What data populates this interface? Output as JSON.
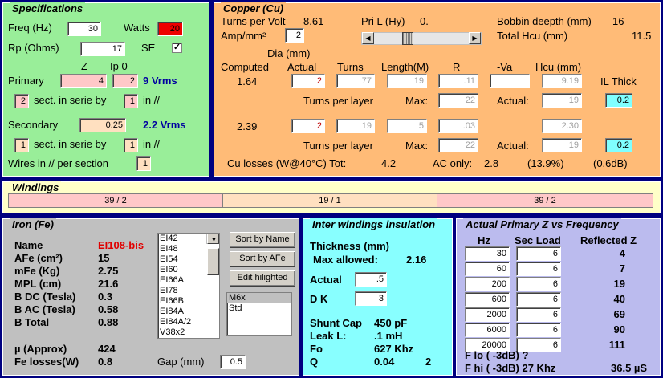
{
  "spec": {
    "title": "Specifications",
    "freq_label": "Freq (Hz)",
    "freq_value": "30",
    "watts_label": "Watts",
    "watts_value": "20",
    "rp_label": "Rp (Ohms)",
    "rp_value": "17",
    "se_label": "SE",
    "se_checked": "✓",
    "z_label": "Z",
    "ip0_label": "Ip 0",
    "primary_label": "Primary",
    "primary_z": "4",
    "primary_ip0": "2",
    "primary_vrms": "9 Vrms",
    "primary_sect": "2",
    "sect_label": "sect. in serie by",
    "primary_by": "1",
    "in_label": "in //",
    "secondary_label": "Secondary",
    "secondary_z": "0.25",
    "secondary_vrms": "2.2 Vrms",
    "secondary_sect": "1",
    "secondary_by": "1",
    "wires_label": "Wires in // per section",
    "wires_value": "1"
  },
  "copper": {
    "title": "Copper (Cu)",
    "tpv_label": "Turns per Volt",
    "tpv_value": "8.61",
    "pril_label": "Pri L (Hy)",
    "pril_value": "0.",
    "bobbin_label": "Bobbin deepth (mm)",
    "bobbin_value": "16",
    "amp_label": "Amp/mm²",
    "amp_value": "2",
    "hcu_label": "Total Hcu (mm)",
    "hcu_value": "11.5",
    "dia_label": "Dia (mm)",
    "computed_label": "Computed",
    "actual_label": "Actual",
    "turns_label": "Turns",
    "length_label": "Length(M)",
    "r_label": "R",
    "va_label": "-Va",
    "hcu_col_label": "Hcu (mm)",
    "p_computed": "1.64",
    "p_actual": "2",
    "p_turns": "77",
    "p_length": "19",
    "p_r": ".11",
    "p_va": "",
    "p_hcu": "9.19",
    "il_label": "IL Thick",
    "tpl_label": "Turns per layer",
    "max_label": "Max:",
    "actual2_label": "Actual:",
    "p_max": "22",
    "p_actual_tpl": "19",
    "p_il": "0.2",
    "s_computed": "2.39",
    "s_actual": "2",
    "s_turns": "19",
    "s_length": "5",
    "s_r": ".03",
    "s_hcu": "2.30",
    "s_max": "22",
    "s_actual_tpl": "19",
    "s_il": "0.2",
    "culoss_label": "Cu losses (W@40°C) Tot:",
    "culoss_tot": "4.2",
    "aconly_label": "AC only:",
    "aconly_value": "2.8",
    "aconly_pct": "(13.9%)",
    "aconly_db": "(0.6dB)"
  },
  "windings": {
    "title": "Windings",
    "segments": [
      "39 / 2",
      "19 / 1",
      "39 / 2"
    ]
  },
  "iron": {
    "title": "Iron (Fe)",
    "name_label": "Name",
    "name_value": "EI108-bis",
    "afe_label": "AFe (cm²)",
    "afe_value": "15",
    "mfe_label": "mFe (Kg)",
    "mfe_value": "2.75",
    "mpl_label": "MPL (cm)",
    "mpl_value": "21.6",
    "bdc_label": "B DC (Tesla)",
    "bdc_value": "0.3",
    "bac_label": "B AC (Tesla)",
    "bac_value": "0.58",
    "btot_label": "B Total",
    "btot_value": "0.88",
    "mu_label": "µ (Approx)",
    "mu_value": "424",
    "fel_label": "Fe losses(W)",
    "fel_value": "0.8",
    "gap_label": "Gap (mm)",
    "gap_value": "0.5",
    "cores": [
      "EI42",
      "EI48",
      "EI54",
      "EI60",
      "EI66A",
      "EI78",
      "EI66B",
      "EI84A",
      "EI84A/2",
      "V38x2"
    ],
    "sort_name": "Sort by Name",
    "sort_afe": "Sort by AFe",
    "edit_hl": "Edit hilighted",
    "materials": [
      "M6x",
      "Std"
    ]
  },
  "insulation": {
    "title": "Inter windings insulation",
    "thick_label": "Thickness (mm)",
    "maxallow_label": "Max allowed:",
    "maxallow_value": "2.16",
    "actual_label": "Actual",
    "actual_value": ".5",
    "dk_label": "D K",
    "dk_value": "3",
    "shunt_label": "Shunt Cap",
    "shunt_value": "450 pF",
    "leak_label": "Leak L:",
    "leak_value": ".1 mH",
    "fo_label": "Fo",
    "fo_value": "627 Khz",
    "q_label": "Q",
    "q_value": "0.04",
    "q_extra": "2"
  },
  "zfreq": {
    "title": "Actual Primary Z vs Frequency",
    "hz_label": "Hz",
    "secload_label": "Sec Load",
    "refz_label": "Reflected Z",
    "rows": [
      {
        "hz": "30",
        "load": "6",
        "z": "4"
      },
      {
        "hz": "60",
        "load": "6",
        "z": "7"
      },
      {
        "hz": "200",
        "load": "6",
        "z": "19"
      },
      {
        "hz": "600",
        "load": "6",
        "z": "40"
      },
      {
        "hz": "2000",
        "load": "6",
        "z": "69"
      },
      {
        "hz": "6000",
        "load": "6",
        "z": "90"
      },
      {
        "hz": "20000",
        "load": "6",
        "z": "111"
      }
    ],
    "flo_label": "F lo ( -3dB) ?",
    "fhi_label": "F hi ( -3dB) 27 Khz",
    "fhi_us": "36.5 µS"
  },
  "colors": {
    "spec_bg": "#99ee99",
    "copper_bg": "#ffbb77",
    "windings_bg": "#ffffc8",
    "iron_bg": "#c0c0c0",
    "insul_bg": "#88ffff",
    "zfreq_bg": "#bbbbee",
    "pink": "#ffc8c8",
    "peach": "#ffe0c0",
    "cyan": "#80ffff"
  }
}
